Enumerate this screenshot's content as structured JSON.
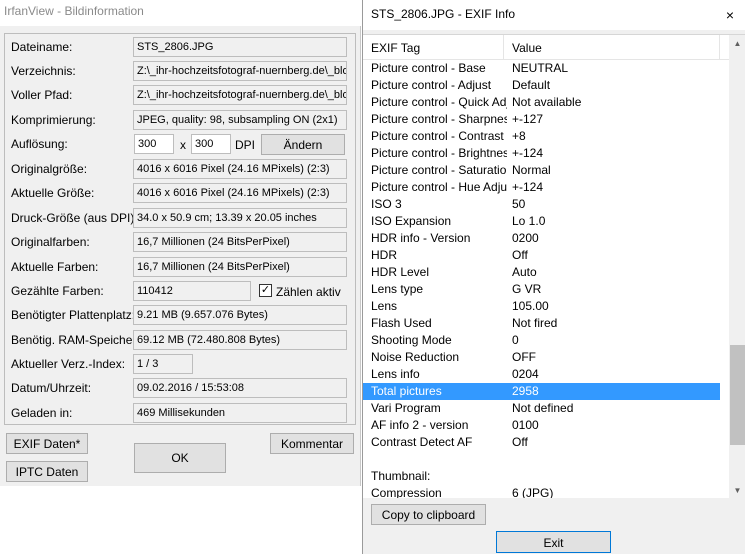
{
  "left_window": {
    "title": "IrfanView - Bildinformation",
    "rows": [
      {
        "label": "Dateiname:",
        "value": "STS_2806.JPG"
      },
      {
        "label": "Verzeichnis:",
        "value": "Z:\\_ihr-hochzeitsfotograf-nuernberg.de\\_blo"
      },
      {
        "label": "Voller Pfad:",
        "value": "Z:\\_ihr-hochzeitsfotograf-nuernberg.de\\_blo"
      },
      {
        "label": "Komprimierung:",
        "value": "JPEG, quality: 98, subsampling ON (2x1)"
      },
      {
        "label": "Auflösung:",
        "value": ""
      },
      {
        "label": "Originalgröße:",
        "value": "4016 x 6016  Pixel (24.16 MPixels) (2:3)"
      },
      {
        "label": "Aktuelle Größe:",
        "value": "4016 x 6016  Pixel (24.16 MPixels) (2:3)"
      },
      {
        "label": "Druck-Größe (aus DPI):",
        "value": "34.0 x 50.9 cm; 13.39 x 20.05 inches"
      },
      {
        "label": "Originalfarben:",
        "value": "16,7 Millionen   (24 BitsPerPixel)"
      },
      {
        "label": "Aktuelle Farben:",
        "value": "16,7 Millionen   (24 BitsPerPixel)"
      },
      {
        "label": "Gezählte Farben:",
        "value": "110412"
      },
      {
        "label": "Benötigter Plattenplatz:",
        "value": "9.21 MB (9.657.076 Bytes)"
      },
      {
        "label": "Benötig. RAM-Speicher:",
        "value": "69.12  MB (72.480.808 Bytes)"
      },
      {
        "label": "Aktueller Verz.-Index:",
        "value": "1  /  3"
      },
      {
        "label": "Datum/Uhrzeit:",
        "value": "09.02.2016 / 15:53:08"
      },
      {
        "label": "Geladen in:",
        "value": "469 Millisekunden"
      }
    ],
    "resolution": {
      "x_value": "300",
      "x_sep": "x",
      "y_value": "300",
      "unit": "DPI",
      "change_button": "Ändern"
    },
    "count_colors_checkbox": {
      "label": "Zählen aktiv",
      "checked": true
    },
    "buttons": {
      "exif": "EXIF Daten*",
      "iptc": "IPTC Daten",
      "ok": "OK",
      "comment": "Kommentar"
    }
  },
  "right_window": {
    "title": "STS_2806.JPG - EXIF Info",
    "close_glyph": "×",
    "columns": {
      "tag": "EXIF Tag",
      "value": "Value"
    },
    "rows": [
      {
        "tag": "Picture control - Base",
        "value": "NEUTRAL"
      },
      {
        "tag": "Picture control - Adjust",
        "value": "Default"
      },
      {
        "tag": "Picture control - Quick Adj...",
        "value": "Not available"
      },
      {
        "tag": "Picture control - Sharpness",
        "value": "+-127"
      },
      {
        "tag": "Picture control - Contrast",
        "value": "+8"
      },
      {
        "tag": "Picture control - Brightness",
        "value": "+-124"
      },
      {
        "tag": "Picture control - Saturation",
        "value": "Normal"
      },
      {
        "tag": "Picture control - Hue Adju...",
        "value": "+-124"
      },
      {
        "tag": "ISO 3",
        "value": "50"
      },
      {
        "tag": "ISO Expansion",
        "value": "Lo 1.0"
      },
      {
        "tag": "HDR info - Version",
        "value": "0200"
      },
      {
        "tag": "HDR",
        "value": "Off"
      },
      {
        "tag": "HDR Level",
        "value": "Auto"
      },
      {
        "tag": "Lens type",
        "value": "G VR"
      },
      {
        "tag": "Lens",
        "value": "105.00"
      },
      {
        "tag": "Flash Used",
        "value": "Not fired"
      },
      {
        "tag": "Shooting Mode",
        "value": "0"
      },
      {
        "tag": "Noise Reduction",
        "value": "OFF"
      },
      {
        "tag": "Lens info",
        "value": "0204"
      },
      {
        "tag": "Total pictures",
        "value": "2958",
        "selected": true
      },
      {
        "tag": "Vari Program",
        "value": "Not defined"
      },
      {
        "tag": "AF info 2 - version",
        "value": "0100"
      },
      {
        "tag": "Contrast Detect AF",
        "value": "Off"
      },
      {
        "tag": "",
        "value": ""
      },
      {
        "tag": "Thumbnail:",
        "value": ""
      },
      {
        "tag": "Compression",
        "value": "6 (JPG)"
      }
    ],
    "buttons": {
      "copy": "Copy to clipboard",
      "exit": "Exit"
    },
    "colors": {
      "selection": "#3399ff"
    }
  }
}
